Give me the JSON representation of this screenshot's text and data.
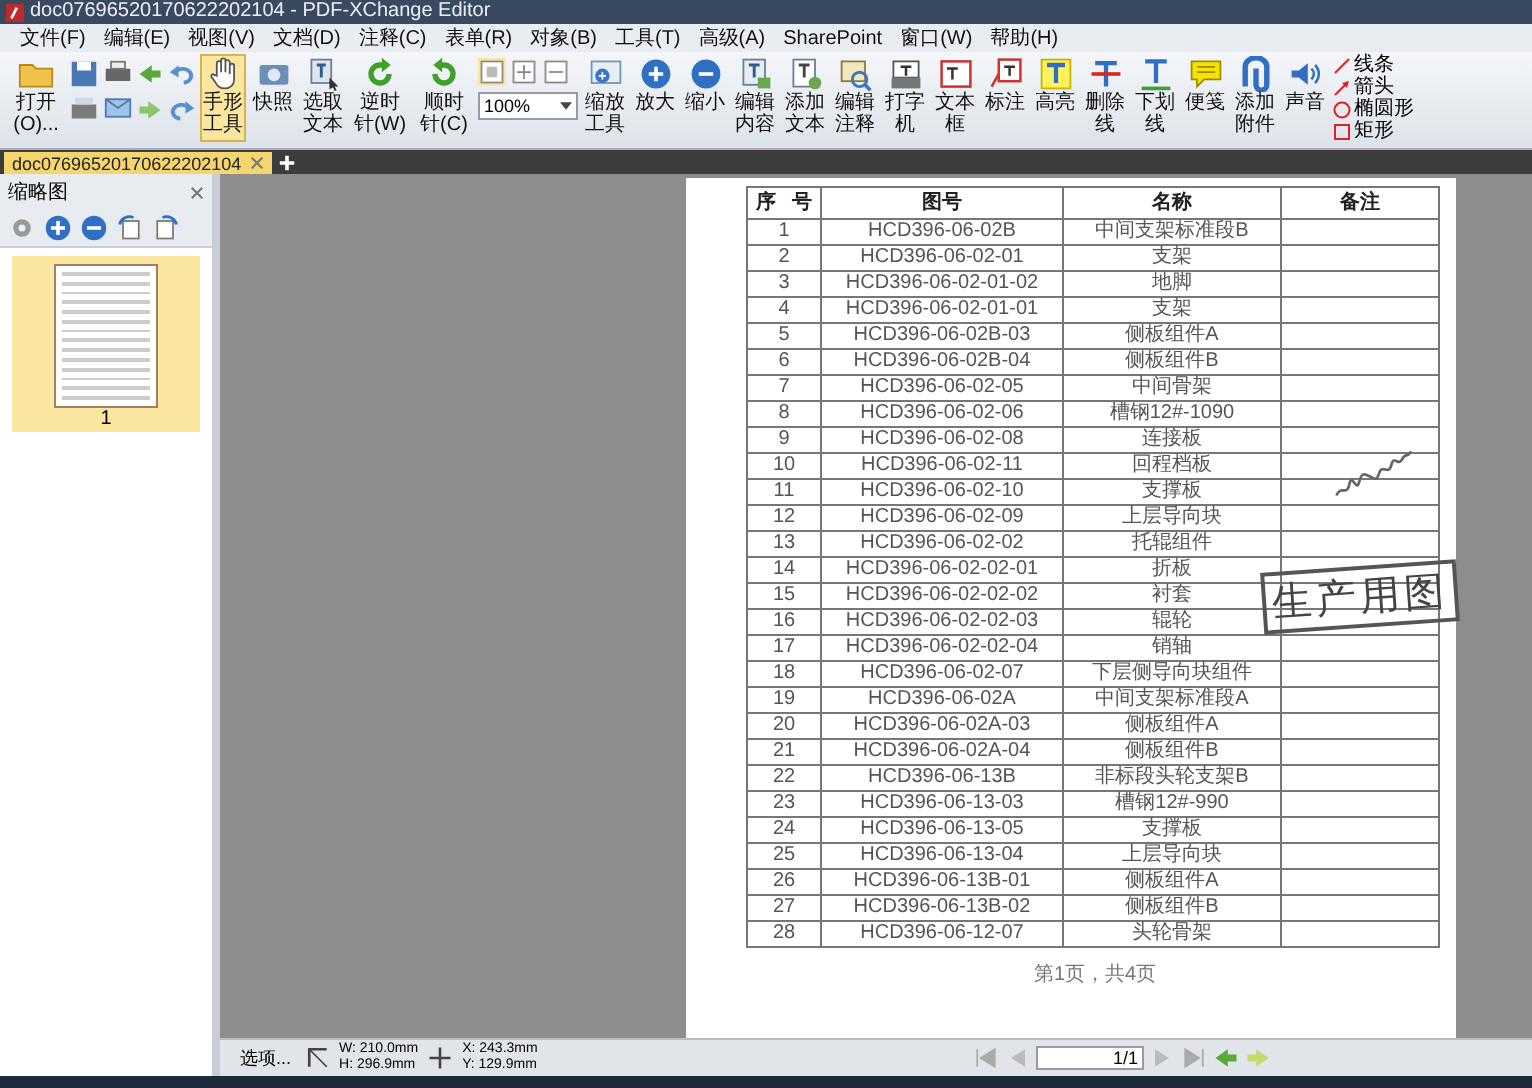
{
  "window": {
    "title": "doc07696520170622202104 - PDF-XChange Editor"
  },
  "menu": [
    "文件(F)",
    "编辑(E)",
    "视图(V)",
    "文档(D)",
    "注释(C)",
    "表单(R)",
    "对象(B)",
    "工具(T)",
    "高级(A)",
    "SharePoint",
    "窗口(W)",
    "帮助(H)"
  ],
  "toolbar": {
    "open": "打开(O)...",
    "zoom": "100%",
    "buttons": [
      {
        "label": "手形工具",
        "kind": "hand",
        "selected": true
      },
      {
        "label": "快照",
        "kind": "camera",
        "selected": false
      },
      {
        "label": "选取文本",
        "kind": "select",
        "selected": false
      },
      {
        "label": "逆时针(W)",
        "kind": "ccw",
        "selected": false
      },
      {
        "label": "顺时针(C)",
        "kind": "cw",
        "selected": false
      },
      {
        "label": "缩放工具",
        "kind": "zoomtool",
        "selected": false
      },
      {
        "label": "放大",
        "kind": "plus",
        "selected": false
      },
      {
        "label": "缩小",
        "kind": "minus",
        "selected": false
      },
      {
        "label": "编辑内容",
        "kind": "editcontent",
        "selected": false
      },
      {
        "label": "添加文本",
        "kind": "addtext",
        "selected": false
      },
      {
        "label": "编辑注释",
        "kind": "editnote",
        "selected": false
      },
      {
        "label": "打字机",
        "kind": "typewriter",
        "selected": false
      },
      {
        "label": "文本框",
        "kind": "textbox",
        "selected": false
      },
      {
        "label": "标注",
        "kind": "callout",
        "selected": false
      },
      {
        "label": "高亮",
        "kind": "highlight",
        "selected": false
      },
      {
        "label": "删除线",
        "kind": "strike",
        "selected": false
      },
      {
        "label": "下划线",
        "kind": "underline",
        "selected": false
      },
      {
        "label": "便笺",
        "kind": "note",
        "selected": false
      },
      {
        "label": "添加附件",
        "kind": "attach",
        "selected": false
      },
      {
        "label": "声音",
        "kind": "sound",
        "selected": false
      }
    ],
    "shapes": [
      {
        "label": "线条",
        "kind": "line"
      },
      {
        "label": "箭头",
        "kind": "arrow"
      },
      {
        "label": "椭圆形",
        "kind": "ellipse"
      },
      {
        "label": "矩形",
        "kind": "rect"
      }
    ]
  },
  "tab": {
    "label": "doc07696520170622202104",
    "selected": true
  },
  "thumbnails": {
    "title": "缩略图",
    "pages": [
      {
        "label": "1",
        "selected": true
      }
    ]
  },
  "table": {
    "columns": [
      "序 号",
      "图号",
      "名称",
      "备注"
    ],
    "rows": [
      [
        "1",
        "HCD396-06-02B",
        "中间支架标准段B"
      ],
      [
        "2",
        "HCD396-06-02-01",
        "支架"
      ],
      [
        "3",
        "HCD396-06-02-01-02",
        "地脚"
      ],
      [
        "4",
        "HCD396-06-02-01-01",
        "支架"
      ],
      [
        "5",
        "HCD396-06-02B-03",
        "侧板组件A"
      ],
      [
        "6",
        "HCD396-06-02B-04",
        "侧板组件B"
      ],
      [
        "7",
        "HCD396-06-02-05",
        "中间骨架"
      ],
      [
        "8",
        "HCD396-06-02-06",
        "槽钢12#-1090"
      ],
      [
        "9",
        "HCD396-06-02-08",
        "连接板"
      ],
      [
        "10",
        "HCD396-06-02-11",
        "回程档板"
      ],
      [
        "11",
        "HCD396-06-02-10",
        "支撑板"
      ],
      [
        "12",
        "HCD396-06-02-09",
        "上层导向块"
      ],
      [
        "13",
        "HCD396-06-02-02",
        "托辊组件"
      ],
      [
        "14",
        "HCD396-06-02-02-01",
        "折板"
      ],
      [
        "15",
        "HCD396-06-02-02-02",
        "衬套"
      ],
      [
        "16",
        "HCD396-06-02-02-03",
        "辊轮"
      ],
      [
        "17",
        "HCD396-06-02-02-04",
        "销轴"
      ],
      [
        "18",
        "HCD396-06-02-07",
        "下层侧导向块组件"
      ],
      [
        "19",
        "HCD396-06-02A",
        "中间支架标准段A"
      ],
      [
        "20",
        "HCD396-06-02A-03",
        "侧板组件A"
      ],
      [
        "21",
        "HCD396-06-02A-04",
        "侧板组件B"
      ],
      [
        "22",
        "HCD396-06-13B",
        "非标段头轮支架B"
      ],
      [
        "23",
        "HCD396-06-13-03",
        "槽钢12#-990"
      ],
      [
        "24",
        "HCD396-06-13-05",
        "支撑板"
      ],
      [
        "25",
        "HCD396-06-13-04",
        "上层导向块"
      ],
      [
        "26",
        "HCD396-06-13B-01",
        "侧板组件A"
      ],
      [
        "27",
        "HCD396-06-13B-02",
        "侧板组件B"
      ],
      [
        "28",
        "HCD396-06-12-07",
        "头轮骨架"
      ]
    ]
  },
  "stamp": "生产用图",
  "page_footer": "第1页，共4页",
  "status_bar": {
    "options": "选项...",
    "width": "W: 210.0mm",
    "height": "H: 296.9mm",
    "x": "X: 243.3mm",
    "y": "Y: 129.9mm",
    "page": "1/1"
  }
}
